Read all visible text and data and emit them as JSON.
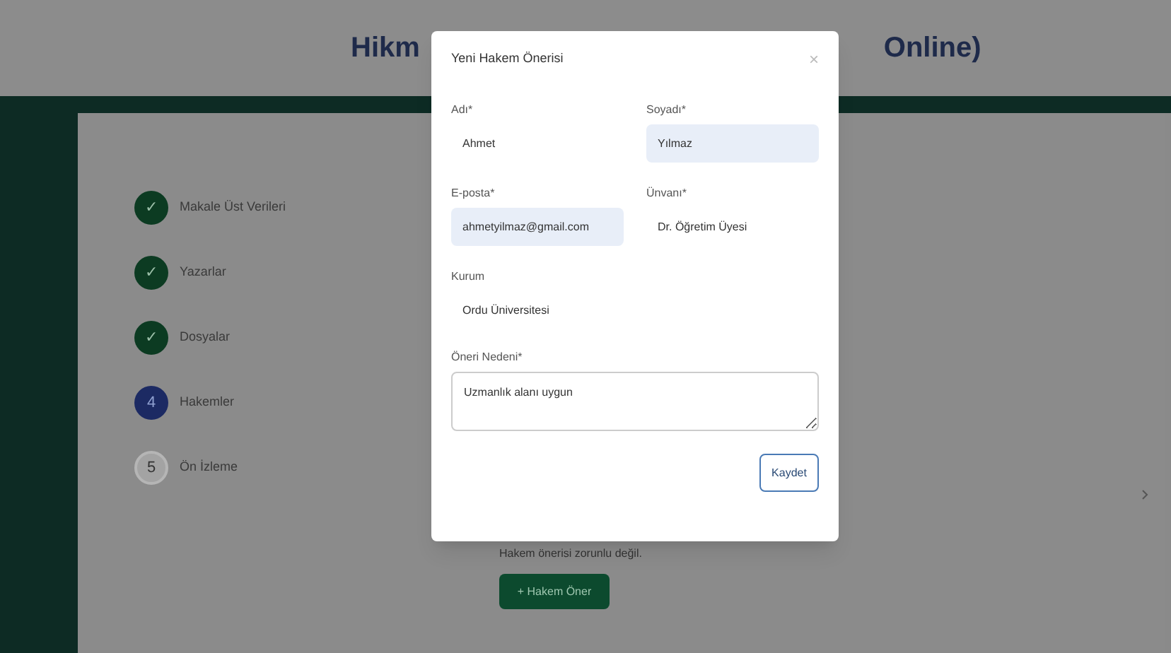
{
  "header": {
    "title_left": "Hikm",
    "title_right": "Online)"
  },
  "steps": [
    {
      "label": "Makale Üst Verileri",
      "kind": "done",
      "marker": "✓"
    },
    {
      "label": "Yazarlar",
      "kind": "done",
      "marker": "✓"
    },
    {
      "label": "Dosyalar",
      "kind": "done",
      "marker": "✓"
    },
    {
      "label": "Hakemler",
      "kind": "current",
      "marker": "4"
    },
    {
      "label": "Ön İzleme",
      "kind": "pending",
      "marker": "5"
    }
  ],
  "content": {
    "note": "Hakem önerisi zorunlu değil.",
    "add_button": "+ Hakem Öner"
  },
  "modal": {
    "title": "Yeni Hakem Önerisi",
    "close": "×",
    "fields": [
      {
        "label": "Adı*",
        "value": "Ahmet",
        "autofilled": false
      },
      {
        "label": "Soyadı*",
        "value": "Yılmaz",
        "autofilled": true
      },
      {
        "label": "E-posta*",
        "value": "ahmetyilmaz@gmail.com",
        "autofilled": true
      },
      {
        "label": "Ünvanı*",
        "value": "Dr. Öğretim Üyesi",
        "autofilled": false
      },
      {
        "label": "Kurum",
        "value": "Ordu Üniversitesi",
        "autofilled": false
      }
    ],
    "textarea": {
      "label": "Öneri Nedeni*",
      "value": "Uzmanlık alanı uygun"
    },
    "save_button": "Kaydet"
  }
}
